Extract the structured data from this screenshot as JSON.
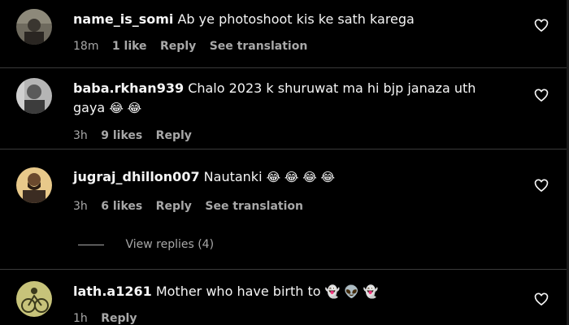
{
  "comments": [
    {
      "username": "name_is_somi",
      "text": "Ab ye photoshoot kis ke sath karega",
      "emojis": "",
      "time": "18m",
      "likes": "1 like",
      "reply": "Reply",
      "translation": "See translation"
    },
    {
      "username": "baba.rkhan939",
      "text": "Chalo 2023 k shuruwat ma hi bjp janaza uth",
      "text_line2": "gaya",
      "emojis": "😂 😂",
      "time": "3h",
      "likes": "9 likes",
      "reply": "Reply"
    },
    {
      "username": "jugraj_dhillon007",
      "text": "Nautanki",
      "emojis": "😂 😂 😂 😂",
      "time": "3h",
      "likes": "6 likes",
      "reply": "Reply",
      "translation": "See translation",
      "view_replies": "View replies (4)"
    },
    {
      "username": "lath.a1261",
      "text": "Mother who have birth to",
      "emojis": "👻 👽 👻",
      "time": "1h",
      "reply": "Reply"
    }
  ],
  "icons": {
    "like": "heart-outline-icon"
  },
  "colors": {
    "background": "#000000",
    "primary_text": "#f5f5f5",
    "secondary_text": "#a8a8a8",
    "divider": "#3a3a3a"
  }
}
